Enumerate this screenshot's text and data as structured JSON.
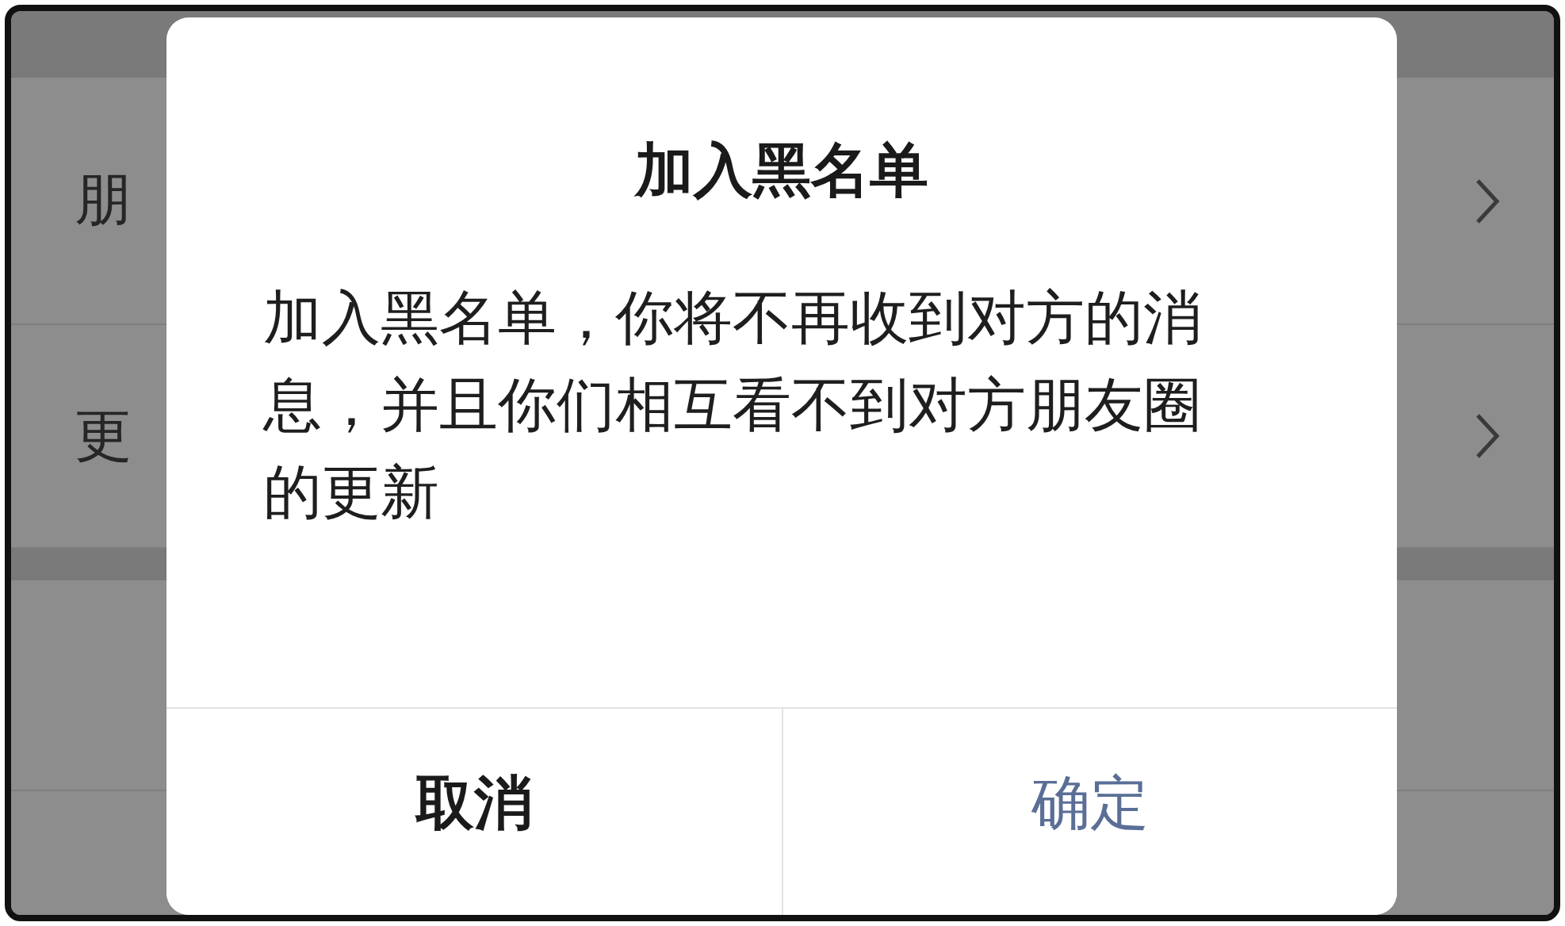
{
  "settings_list": {
    "rows": [
      {
        "label": "朋"
      },
      {
        "label": "更"
      }
    ]
  },
  "dialog": {
    "title": "加入黑名单",
    "message": "加入黑名单，你将不再收到对方的消息，并且你们相互看不到对方朋友圈的更新",
    "buttons": [
      {
        "label": "取消",
        "kind": "cancel"
      },
      {
        "label": "确定",
        "kind": "confirm"
      }
    ]
  }
}
